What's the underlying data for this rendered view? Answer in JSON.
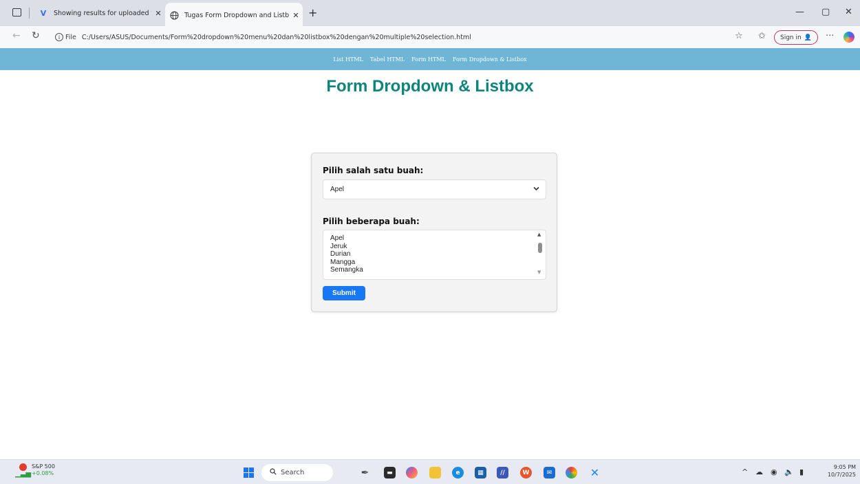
{
  "browser": {
    "tabs": [
      {
        "title": "Showing results for uploaded file",
        "favicon": "v-logo-icon"
      },
      {
        "title": "Tugas Form Dropdown and Listbox",
        "favicon": "globe-icon",
        "active": true
      }
    ],
    "url_prefix": "File",
    "url": "C:/Users/ASUS/Documents/Form%20dropdown%20menu%20dan%20listbox%20dengan%20multiple%20selection.html",
    "sign_in_label": "Sign in"
  },
  "nav": {
    "links": [
      "List HTML",
      "Tabel HTML",
      "Form HTML",
      "Form Dropdown & Listbox"
    ]
  },
  "page": {
    "title": "Form Dropdown & Listbox"
  },
  "form": {
    "dropdown_label": "Pilih salah satu buah:",
    "dropdown_selected": "Apel",
    "listbox_label": "Pilih beberapa buah:",
    "listbox_options": [
      "Apel",
      "Jeruk",
      "Durian",
      "Mangga",
      "Semangka"
    ],
    "submit_label": "Submit",
    "accent_color": "#1877f2",
    "title_color": "#0d857c",
    "nav_color": "#6fb5d6"
  },
  "taskbar": {
    "stock_name": "S&P 500",
    "stock_change": "+0.08%",
    "search_placeholder": "Search",
    "time": "9:05 PM",
    "date": "10/7/2025"
  }
}
